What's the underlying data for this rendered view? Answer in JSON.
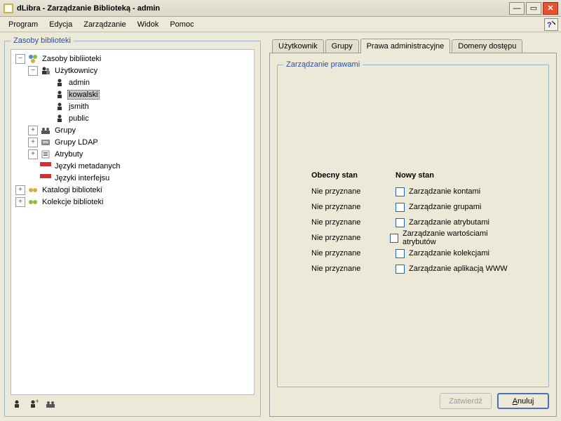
{
  "window": {
    "title": "dLibra - Zarządzanie Biblioteką - admin"
  },
  "menu": {
    "items": [
      "Program",
      "Edycja",
      "Zarządzanie",
      "Widok",
      "Pomoc"
    ]
  },
  "left": {
    "legend": "Zasoby biblioteki",
    "tree": {
      "root": "Zasoby bibliioteki",
      "users": "Użytkownicy",
      "u_admin": "admin",
      "u_kowalski": "kowalski",
      "u_jsmith": "jsmith",
      "u_public": "public",
      "groups": "Grupy",
      "ldap": "Grupy LDAP",
      "attrs": "Atrybuty",
      "meta": "Języki metadanych",
      "ui": "Języki interfejsu",
      "catalogs": "Katalogi biblioteki",
      "collections": "Kolekcje biblioteki"
    }
  },
  "tabs": {
    "t0": "Użytkownik",
    "t1": "Grupy",
    "t2": "Prawa administracyjne",
    "t3": "Domeny dostępu"
  },
  "rights": {
    "legend": "Zarządzanie prawami",
    "head_current": "Obecny stan",
    "head_new": "Nowy stan",
    "rows": [
      {
        "state": "Nie przyznane",
        "label": "Zarządzanie kontami"
      },
      {
        "state": "Nie przyznane",
        "label": "Zarządzanie grupami"
      },
      {
        "state": "Nie przyznane",
        "label": "Zarządzanie atrybutami"
      },
      {
        "state": "Nie przyznane",
        "label": "Zarządzanie wartościami atrybutów"
      },
      {
        "state": "Nie przyznane",
        "label": "Zarządzanie kolekcjami"
      },
      {
        "state": "Nie przyznane",
        "label": "Zarządzanie aplikacją WWW"
      }
    ]
  },
  "buttons": {
    "ok": "Zatwierdź",
    "cancel": "Anuluj"
  }
}
